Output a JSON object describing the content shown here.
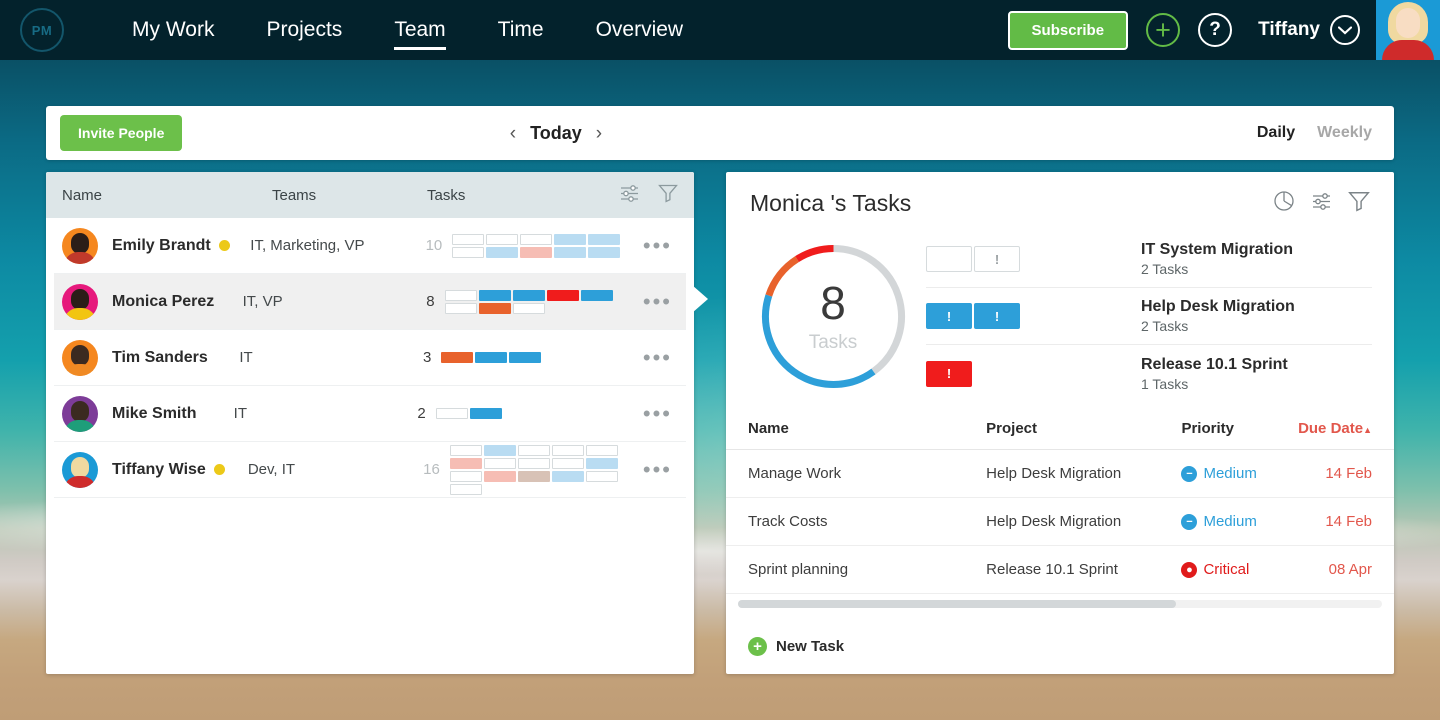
{
  "header": {
    "logo_text": "PM",
    "nav": [
      {
        "label": "My Work",
        "active": false
      },
      {
        "label": "Projects",
        "active": false
      },
      {
        "label": "Team",
        "active": true
      },
      {
        "label": "Time",
        "active": false
      },
      {
        "label": "Overview",
        "active": false
      }
    ],
    "subscribe_label": "Subscribe",
    "add_icon": "+",
    "help_icon": "?",
    "username": "Tiffany"
  },
  "toolbar": {
    "invite_label": "Invite People",
    "prev_icon": "‹",
    "date_label": "Today",
    "next_icon": "›",
    "modes": [
      {
        "label": "Daily",
        "selected": true
      },
      {
        "label": "Weekly",
        "selected": false
      }
    ]
  },
  "people_panel": {
    "columns": [
      "Name",
      "Teams",
      "Tasks"
    ],
    "rows": [
      {
        "name": "Emily Brandt",
        "teams": "IT, Marketing, VP",
        "count": "10",
        "flag": true,
        "selected": false,
        "count_muted": true,
        "avatar": {
          "ring": "#f5871f",
          "hair": "#2b1d18",
          "body": "#c0392b"
        },
        "grid": [
          [
            "empty",
            "empty",
            "empty",
            "lightblue",
            "lightblue"
          ],
          [
            "empty",
            "lightblue",
            "lightred",
            "lightblue",
            "lightblue"
          ]
        ]
      },
      {
        "name": "Monica Perez",
        "teams": "IT, VP",
        "count": "8",
        "flag": false,
        "selected": true,
        "count_muted": false,
        "avatar": {
          "ring": "#e6197c",
          "hair": "#2b1d18",
          "body": "#f2c511"
        },
        "grid": [
          [
            "empty",
            "blue",
            "blue",
            "red",
            "blue"
          ],
          [
            "empty",
            "orange",
            "empty",
            "none",
            "none"
          ]
        ]
      },
      {
        "name": "Tim Sanders",
        "teams": "IT",
        "count": "3",
        "flag": false,
        "selected": false,
        "count_muted": false,
        "avatar": {
          "ring": "#f5871f",
          "hair": "#3b2a20",
          "body": "#f08a24"
        },
        "grid": [
          [
            "orange",
            "blue",
            "blue",
            "none",
            "none"
          ]
        ]
      },
      {
        "name": "Mike Smith",
        "teams": "IT",
        "count": "2",
        "flag": false,
        "selected": false,
        "count_muted": false,
        "avatar": {
          "ring": "#7d3c98",
          "hair": "#3b2a20",
          "body": "#1e9e7a"
        },
        "grid": [
          [
            "empty",
            "blue",
            "none",
            "none",
            "none"
          ]
        ]
      },
      {
        "name": "Tiffany Wise",
        "teams": "Dev, IT",
        "count": "16",
        "flag": true,
        "selected": false,
        "count_muted": true,
        "avatar": {
          "ring": "#1b9ad6",
          "hair": "#f0d9a0",
          "body": "#cf2b2b"
        },
        "grid": [
          [
            "empty",
            "lightblue",
            "empty",
            "empty",
            "empty"
          ],
          [
            "lightred",
            "empty",
            "empty",
            "empty",
            "lightblue"
          ],
          [
            "empty",
            "lightred",
            "lightbrown",
            "lightblue",
            "empty"
          ],
          [
            "empty",
            "none",
            "none",
            "none",
            "none"
          ]
        ]
      }
    ]
  },
  "task_panel": {
    "title": "Monica 's Tasks",
    "donut": {
      "value": "8",
      "caption": "Tasks",
      "segments": [
        {
          "name": "remaining",
          "color": "#d3d6d8",
          "percent": 40
        },
        {
          "name": "blue",
          "color": "#2d9fd9",
          "percent": 40
        },
        {
          "name": "orange",
          "color": "#e8622c",
          "percent": 11
        },
        {
          "name": "red",
          "color": "#f01c1c",
          "percent": 9
        }
      ]
    },
    "projects": [
      {
        "name": "IT System Migration",
        "tasks": "2 Tasks",
        "chips": [
          {
            "style": "empty",
            "glyph": ""
          },
          {
            "style": "empty",
            "glyph": "!"
          }
        ]
      },
      {
        "name": "Help Desk Migration",
        "tasks": "2 Tasks",
        "chips": [
          {
            "style": "blue",
            "glyph": "!"
          },
          {
            "style": "blue",
            "glyph": "!"
          }
        ]
      },
      {
        "name": "Release 10.1 Sprint",
        "tasks": "1 Tasks",
        "chips": [
          {
            "style": "red",
            "glyph": "!"
          }
        ]
      }
    ],
    "table": {
      "columns": [
        "Name",
        "Project",
        "Priority",
        "Due Date"
      ],
      "sort_icon": "▲",
      "rows": [
        {
          "name": "Manage Work",
          "project": "Help Desk Migration",
          "priority": "Medium",
          "priority_color": "#2d9fd9",
          "priority_glyph": "−",
          "due": "14 Feb"
        },
        {
          "name": "Track Costs",
          "project": "Help Desk Migration",
          "priority": "Medium",
          "priority_color": "#2d9fd9",
          "priority_glyph": "−",
          "due": "14 Feb"
        },
        {
          "name": "Sprint planning",
          "project": "Release 10.1 Sprint",
          "priority": "Critical",
          "priority_color": "#e01b1b",
          "priority_glyph": "●",
          "due": "08 Apr"
        }
      ]
    },
    "new_task_label": "New Task"
  },
  "colors": {
    "green": "#62bb46",
    "blue": "#2d9fd9",
    "red": "#f01c1c",
    "orange": "#e8622c",
    "lightblue": "#b9dcf2",
    "lightred": "#f6bdb4",
    "lightbrown": "#d8c2b6",
    "header_bg": "#03222c"
  }
}
